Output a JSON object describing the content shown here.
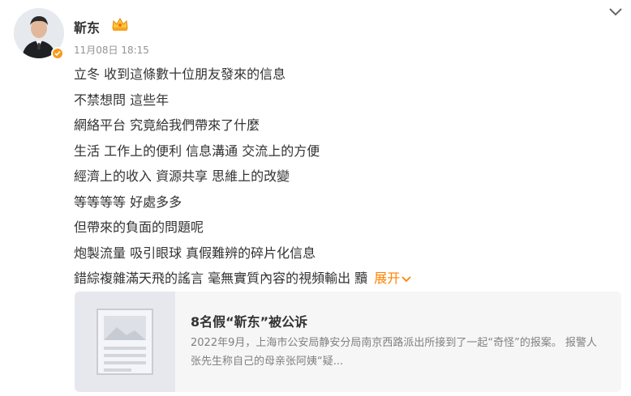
{
  "user": {
    "name": "靳东",
    "timestamp": "11月08日 18:15",
    "avatar_icon": "avatar-portrait-icon",
    "badge_icon": "verified-badge-icon"
  },
  "post": {
    "lines": [
      "立冬 收到這條數十位朋友發來的信息",
      "不禁想問 這些年",
      "網絡平台 究竟給我們帶來了什麼",
      "生活 工作上的便利 信息溝通 交流上的方便",
      "經濟上的收入 資源共享 思維上的改變",
      "等等等等 好處多多",
      "但帶來的負面的問題呢",
      "炮製流量 吸引眼球 真假難辨的碎片化信息",
      "錯綜複雜滿天飛的謠言 毫無實質內容的視頻輸出 黷"
    ],
    "expand_label": "展开"
  },
  "card": {
    "title": "8名假“靳东”被公诉",
    "description": "2022年9月，上海市公安局静安分局南京西路派出所接到了一起“奇怪”的报案。 报警人张先生称自己的母亲张阿姨“疑..."
  },
  "colors": {
    "accent": "#ff8200",
    "badge": "#f79a1b",
    "card_bg": "#f6f6f6",
    "thumb_bg": "#e6e8ed"
  }
}
